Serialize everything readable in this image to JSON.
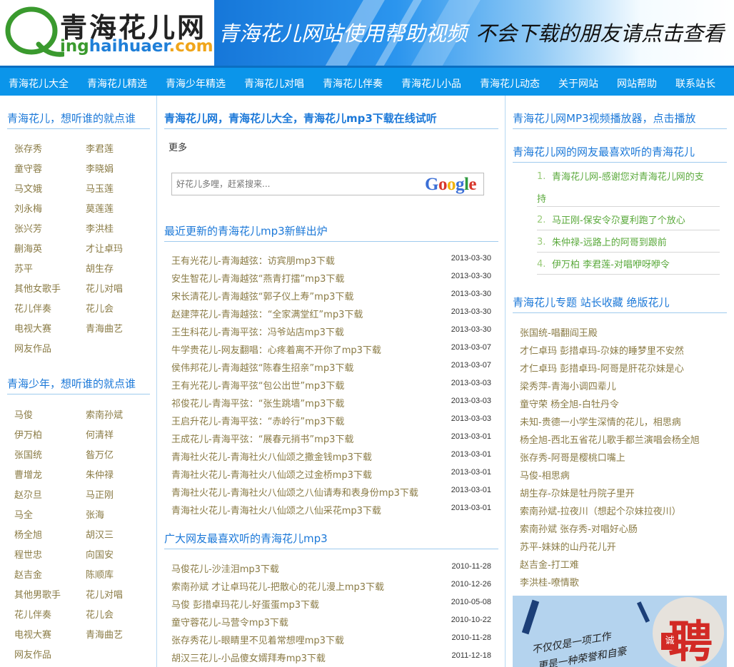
{
  "header": {
    "logo_cn": "青海花儿网",
    "logo_en_q": "Q",
    "logo_en_ing": "ing",
    "logo_en_hai": "haihuaer",
    "logo_en_com": ".com",
    "banner_left": "青海花儿网站使用帮助视频",
    "banner_right": "不会下载的朋友请点击查看"
  },
  "nav": [
    "青海花儿大全",
    "青海花儿精选",
    "青海少年精选",
    "青海花儿对唱",
    "青海花儿伴奏",
    "青海花儿小品",
    "青海花儿动态",
    "关于网站",
    "网站帮助",
    "联系站长"
  ],
  "left": {
    "section1_title": "青海花儿，想听谁的就点谁",
    "section1_items": [
      "张存秀",
      "李君莲",
      "童守蓉",
      "李晓娟",
      "马文娥",
      "马玉莲",
      "刘永梅",
      "莫莲莲",
      "张兴芳",
      "李洪桂",
      "蒯海英",
      "才让卓玛",
      "苏平",
      "胡生存",
      "其他女歌手",
      "花儿对唱",
      "花儿伴奏",
      "花儿会",
      "电视大赛",
      "青海曲艺",
      "网友作品"
    ],
    "section2_title": "青海少年，想听谁的就点谁",
    "section2_items": [
      "马俊",
      "索南孙斌",
      "伊万柏",
      "何清祥",
      "张国统",
      "昝万亿",
      "曹增龙",
      "朱仲禄",
      "赵尕旦",
      "马正刚",
      "马全",
      "张海",
      "杨全旭",
      "胡汉三",
      "程世忠",
      "向国安",
      "赵吉金",
      "陈顺库",
      "其他男歌手",
      "花儿对唱",
      "花儿伴奏",
      "花儿会",
      "电视大赛",
      "青海曲艺",
      "网友作品"
    ]
  },
  "mid": {
    "title": "青海花儿网，青海花儿大全，青海花儿mp3下载在线试听",
    "more": "更多",
    "search_placeholder": "好花儿多哩，赶紧搜来...",
    "google": [
      "G",
      "o",
      "o",
      "g",
      "l",
      "e"
    ],
    "google_colors": [
      "#3b6fd6",
      "#d8362b",
      "#f2b30e",
      "#3b6fd6",
      "#2e9a3f",
      "#d8362b"
    ],
    "recent_title": "最近更新的青海花儿mp3新鲜出炉",
    "recent": [
      {
        "t": "王有光花儿-青海越弦：访宾朋mp3下载",
        "d": "2013-03-30"
      },
      {
        "t": "安生智花儿-青海越弦“燕青打擂”mp3下载",
        "d": "2013-03-30"
      },
      {
        "t": "宋长清花儿-青海越弦“郭子仪上寿”mp3下载",
        "d": "2013-03-30"
      },
      {
        "t": "赵建萍花儿-青海越弦：“全家满堂红”mp3下载",
        "d": "2013-03-30"
      },
      {
        "t": "王生科花儿-青海平弦：冯爷站店mp3下载",
        "d": "2013-03-30"
      },
      {
        "t": "牛学贵花儿-网友翻唱：心疼着离不开你了mp3下载",
        "d": "2013-03-07"
      },
      {
        "t": "侯伟邦花儿-青海越弦“陈春生招亲”mp3下载",
        "d": "2013-03-07"
      },
      {
        "t": "王有光花儿-青海平弦“包公出世”mp3下载",
        "d": "2013-03-03"
      },
      {
        "t": "祁俊花儿-青海平弦：“张生跳墙”mp3下载",
        "d": "2013-03-03"
      },
      {
        "t": "王启升花儿-青海平弦：“赤岭行”mp3下载",
        "d": "2013-03-03"
      },
      {
        "t": "王成花儿-青海平弦：“展春元捎书”mp3下载",
        "d": "2013-03-01"
      },
      {
        "t": "青海社火花儿-青海社火八仙颂之撒金钱mp3下载",
        "d": "2013-03-01"
      },
      {
        "t": "青海社火花儿-青海社火八仙颂之过金桥mp3下载",
        "d": "2013-03-01"
      },
      {
        "t": "青海社火花儿-青海社火八仙颂之八仙请寿和表身份mp3下载",
        "d": "2013-03-01"
      },
      {
        "t": "青海社火花儿-青海社火八仙颂之八仙采花mp3下载",
        "d": "2013-03-01"
      }
    ],
    "popular_title": "广大网友最喜欢听的青海花儿mp3",
    "popular": [
      {
        "t": "马俊花儿-沙洼泪mp3下载",
        "d": "2010-11-28"
      },
      {
        "t": "索南孙斌 才让卓玛花儿-把散心的花儿漫上mp3下载",
        "d": "2010-12-26"
      },
      {
        "t": "马俊 彭措卓玛花儿-好蛋蛋mp3下载",
        "d": "2010-05-08"
      },
      {
        "t": "童守蓉花儿-马营令mp3下载",
        "d": "2010-10-22"
      },
      {
        "t": "张存秀花儿-眼睛里不见着常想哩mp3下载",
        "d": "2010-11-28"
      },
      {
        "t": "胡汉三花儿-小品傻女婿拜寿mp3下载",
        "d": "2011-12-18"
      }
    ]
  },
  "right": {
    "player_title": "青海花儿网MP3视频播放器，点击播放",
    "fav_title": "青海花儿网的网友最喜欢听的青海花儿",
    "fav": [
      {
        "n": "1.",
        "line1": "青海花儿网-感谢您对青海花儿网的支",
        "line2": "持"
      },
      {
        "n": "2.",
        "line1": "马正刚-保安令尕夏利跑了个放心"
      },
      {
        "n": "3.",
        "line1": "朱仲禄-远路上的阿哥到跟前"
      },
      {
        "n": "4.",
        "line1": "伊万柏 李君莲-对唱咿呀咿令"
      }
    ],
    "special_title": "青海花儿专题 站长收藏 绝版花儿",
    "special": [
      "张国统-唱翻阎王殿",
      "才仁卓玛 彭措卓玛-尕妹的睡梦里不安然",
      "才仁卓玛 彭措卓玛-阿哥是肝花尕妹是心",
      "梁秀萍-青海小调四辈儿",
      "童守荣 杨全旭-白牡丹令",
      "未知-贵德一小学生深情的花儿，相思病",
      "杨全旭-西北五省花儿歌手都兰演唱会杨全旭",
      "张存秀-阿哥是樱桃口嘴上",
      "马俊-相思病",
      "胡生存-尕妹是牡丹院子里开",
      "索南孙斌-拉夜川（想起个尕妹拉夜川）",
      "索南孙斌 张存秀-对唱好心肠",
      "苏平-妹妹的山丹花儿开",
      "赵吉金-打工难",
      "李洪桂-嘹情歌"
    ],
    "ad_text_line1": "不仅仅是一项工作",
    "ad_text_line2": "更是一种荣誉和自豪",
    "ad_char": "聘",
    "ad_seal": "诚"
  }
}
